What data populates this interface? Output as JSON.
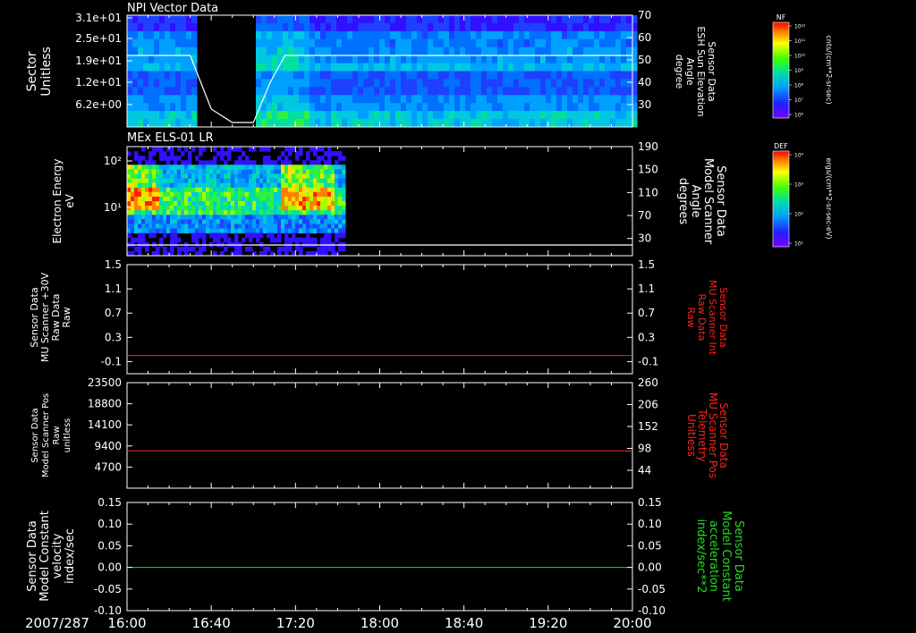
{
  "date_label": "2007/287",
  "time_axis": {
    "start": "16:00",
    "end": "20:00",
    "tick_labels": [
      "16:00",
      "16:40",
      "17:20",
      "18:00",
      "18:40",
      "19:20",
      "20:00"
    ]
  },
  "colors": {
    "background": "#000000",
    "axis": "#ffffff",
    "red_trace": "#ff2020",
    "green_trace": "#22dd22",
    "right_label_red": "#ff2020",
    "right_label_green": "#22dd22"
  },
  "colorbars": [
    {
      "title": "NF",
      "unit": "cnts/(cm**2-sr-sec)",
      "ticks": [
        "10¹²",
        "10¹¹",
        "10¹⁰",
        "10⁹",
        "10⁸",
        "10⁷",
        "10⁶"
      ]
    },
    {
      "title": "DEF",
      "unit": "ergs/(cm**2-sr-sec-eV)",
      "ticks": [
        "10⁴",
        "10³",
        "10²",
        "10¹"
      ]
    }
  ],
  "chart_data": [
    {
      "type": "heatmap",
      "title": "NPI Vector Data",
      "ylabel": [
        "Sector",
        "Unitless"
      ],
      "yticks": [
        "3.1e+01",
        "2.5e+01",
        "1.9e+01",
        "1.2e+01",
        "6.2e+00"
      ],
      "right_label": [
        "Sensor Data",
        "ESH Sun Elevation",
        "Angle",
        "degree"
      ],
      "right_ticks": [
        "70",
        "60",
        "50",
        "40",
        "30"
      ],
      "right_ylim": [
        20,
        70
      ],
      "data_gap_hours": [
        [
          16.58,
          17.0
        ]
      ],
      "overlay_line": {
        "name": "ESH Sun Elevation Angle",
        "x": [
          "16:00",
          "16:30",
          "16:35",
          "16:40",
          "16:50",
          "16:56",
          "17:00",
          "17:08",
          "17:15",
          "20:00"
        ],
        "y": [
          52,
          52,
          40,
          28,
          22,
          22,
          22,
          40,
          52,
          52
        ]
      }
    },
    {
      "type": "heatmap",
      "title": "MEx ELS-01 LR",
      "ylabel": [
        "Electron Energy",
        "eV"
      ],
      "yticks": [
        "10²",
        "10¹"
      ],
      "right_label": [
        "Sensor Data",
        "Model Scanner",
        "Angle",
        "degrees"
      ],
      "right_ticks": [
        "190",
        "150",
        "110",
        "70",
        "30"
      ],
      "right_ylim": [
        0,
        190
      ],
      "data_extent": [
        "16:00",
        "17:42"
      ],
      "overlay_line": {
        "name": "Model Scanner Angle",
        "x": [
          "16:00",
          "20:00"
        ],
        "y": [
          10,
          10
        ]
      }
    },
    {
      "type": "line",
      "ylabel": [
        "Sensor Data",
        "MU Scanner +30V",
        "Raw Data",
        "Raw"
      ],
      "yticks": [
        "1.5",
        "1.1",
        "0.7",
        "0.3",
        "-0.1"
      ],
      "ylim": [
        -0.3,
        1.5
      ],
      "right_label": [
        "Sensor Data",
        "MU Scanner Int",
        "Raw Data",
        "Raw"
      ],
      "right_ticks": [
        "1.5",
        "1.1",
        "0.7",
        "0.3",
        "-0.1"
      ],
      "right_ylim": [
        -0.3,
        1.5
      ],
      "series": [
        {
          "x": [
            "16:00",
            "20:00"
          ],
          "y": [
            0.0,
            0.0
          ]
        }
      ]
    },
    {
      "type": "line",
      "ylabel": [
        "Sensor Data",
        "Model Scanner Pos",
        "Raw",
        "unitless"
      ],
      "yticks": [
        "23500",
        "18800",
        "14100",
        "9400",
        "4700"
      ],
      "ylim": [
        0,
        23500
      ],
      "right_label": [
        "Sensor Data",
        "MU Scanner Pos",
        "Telemetry",
        "Unitless"
      ],
      "right_ticks": [
        "260",
        "206",
        "152",
        "98",
        "44"
      ],
      "right_ylim": [
        0,
        260
      ],
      "series": [
        {
          "x": [
            "16:00",
            "20:00"
          ],
          "y": [
            8300,
            8300
          ]
        }
      ]
    },
    {
      "type": "line",
      "ylabel": [
        "Sensor Data",
        "Model Constant",
        "velocity",
        "index/sec"
      ],
      "yticks": [
        "0.15",
        "0.10",
        "0.05",
        "0.00",
        "-0.05",
        "-0.10"
      ],
      "ylim": [
        -0.1,
        0.15
      ],
      "right_label": [
        "Sensor Data",
        "Model Constant",
        "acceleration",
        "index/sec**2"
      ],
      "right_ticks": [
        "0.15",
        "0.10",
        "0.05",
        "0.00",
        "-0.05",
        "-0.10"
      ],
      "right_ylim": [
        -0.1,
        0.15
      ],
      "series": [
        {
          "x": [
            "16:00",
            "20:00"
          ],
          "y": [
            0.0,
            0.0
          ]
        }
      ]
    }
  ]
}
